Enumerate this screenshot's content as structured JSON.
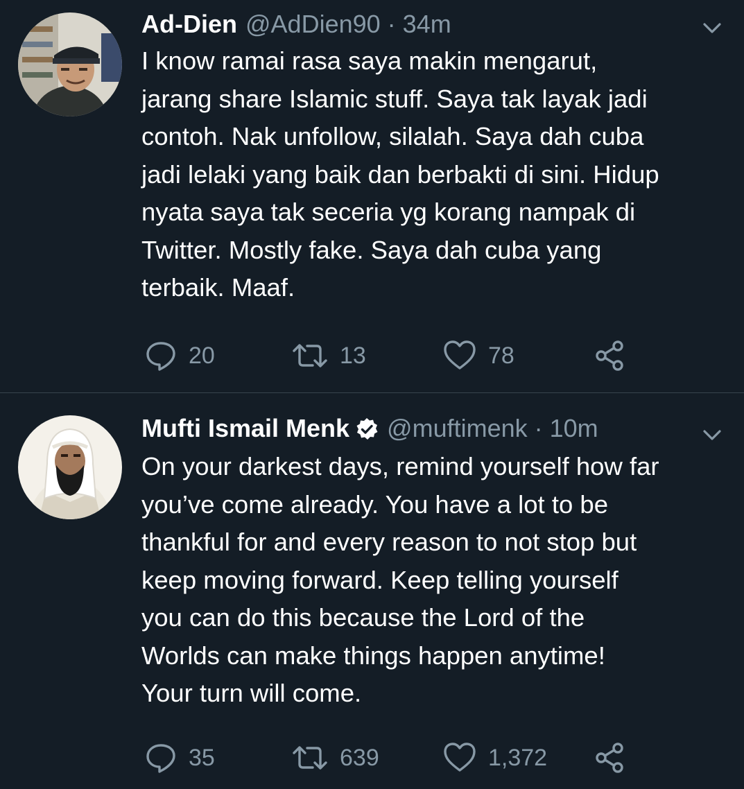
{
  "tweets": [
    {
      "display_name": "Ad-Dien",
      "handle": "@AdDien90",
      "separator": "·",
      "time": "34m",
      "verified": false,
      "text": "I know ramai rasa saya makin mengarut,\njarang share Islamic stuff. Saya tak layak jadi\ncontoh. Nak unfollow, silalah. Saya dah cuba\njadi lelaki yang baik dan berbakti di sini. Hidup\nnyata saya tak seceria yg korang nampak di\nTwitter. Mostly fake. Saya dah cuba yang\nterbaik. Maaf.",
      "replies": "20",
      "retweets": "13",
      "likes": "78"
    },
    {
      "display_name": "Mufti Ismail Menk",
      "handle": "@muftimenk",
      "separator": "·",
      "time": "10m",
      "verified": true,
      "text": "On your darkest days, remind yourself how far\nyou’ve come already. You have a lot to be\nthankful for and every reason to not stop but\nkeep moving forward. Keep telling yourself\nyou can do this because the Lord of the\nWorlds can make things happen anytime!\nYour turn will come.",
      "replies": "35",
      "retweets": "639",
      "likes": "1,372"
    }
  ],
  "colors": {
    "background": "#141d26",
    "text": "#ffffff",
    "secondary": "#8899a6",
    "divider": "#38444d"
  }
}
